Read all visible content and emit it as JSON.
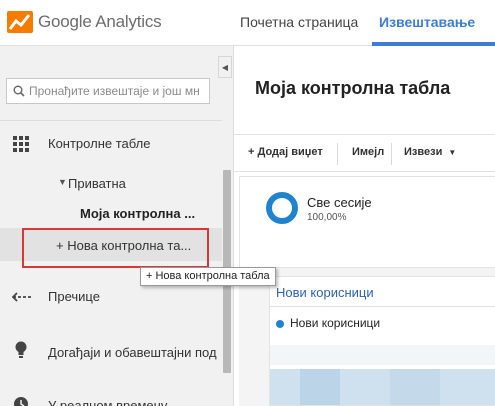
{
  "header": {
    "logo_word1": "Google",
    "logo_word2": "Analytics",
    "nav_home": "Почетна страница",
    "nav_reports": "Извештавање",
    "accent_color": "#3b7dd8"
  },
  "sidebar": {
    "search_placeholder": "Пронађите извештаје и још мн",
    "items": [
      {
        "icon": "grid-icon",
        "label": "Контролне табле"
      },
      {
        "label": "Приватна"
      },
      {
        "label": "Моја контролна ..."
      },
      {
        "label": "+ Нова контролна та..."
      },
      {
        "icon": "behavior-flow-icon",
        "label": "Пречице"
      },
      {
        "icon": "lightbulb-icon",
        "label": "Догађаји и обавештајни под"
      },
      {
        "icon": "clock-icon",
        "label": "У реалном времену"
      }
    ],
    "highlight_color": "#d93636"
  },
  "main": {
    "title": "Моја контролна табла",
    "toolbar": {
      "add_widget": "+ Додај виџет",
      "email": "Имејл",
      "export": "Извези"
    },
    "widget1": {
      "title": "Све сесије",
      "percent": "100,00%"
    },
    "widget2": {
      "title": "Нови корисници",
      "legend": "Нови корисници",
      "series_color": "#1e84d0"
    }
  },
  "tooltip": {
    "text": "+ Нова контролна табла"
  }
}
